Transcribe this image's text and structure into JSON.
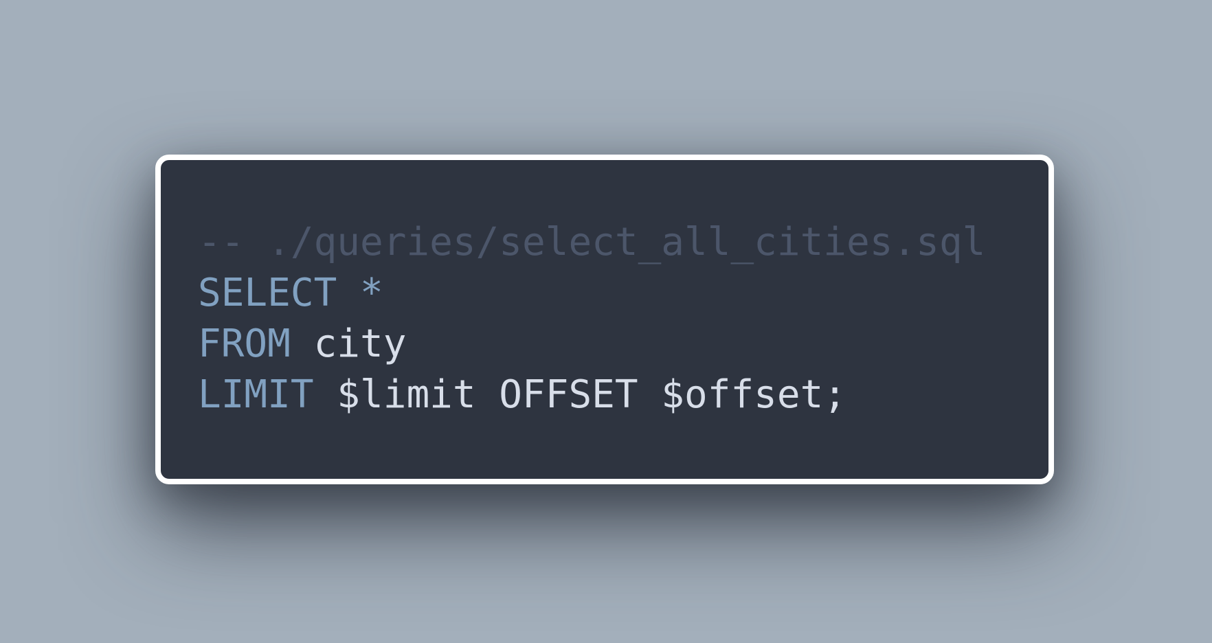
{
  "colors": {
    "background": "#a3afbb",
    "card_background": "#2e3440",
    "card_border": "#ffffff",
    "comment": "#4c566a",
    "keyword": "#81a1c1",
    "plain": "#d8dee9"
  },
  "code": {
    "language": "sql",
    "lines": [
      {
        "tokens": [
          {
            "text": "-- ./queries/select_all_cities.sql",
            "kind": "comment"
          }
        ]
      },
      {
        "tokens": [
          {
            "text": "SELECT",
            "kind": "keyword"
          },
          {
            "text": " ",
            "kind": "plain"
          },
          {
            "text": "*",
            "kind": "keyword"
          }
        ]
      },
      {
        "tokens": [
          {
            "text": "FROM",
            "kind": "keyword"
          },
          {
            "text": " city",
            "kind": "plain"
          }
        ]
      },
      {
        "tokens": [
          {
            "text": "LIMIT",
            "kind": "keyword"
          },
          {
            "text": " $limit OFFSET $offset;",
            "kind": "plain"
          }
        ]
      }
    ]
  }
}
